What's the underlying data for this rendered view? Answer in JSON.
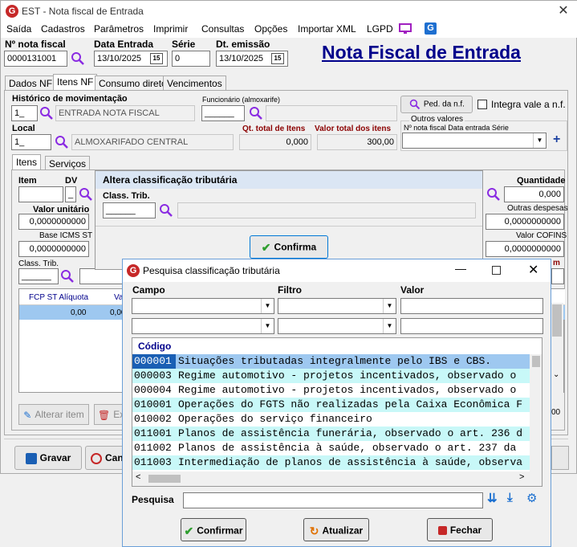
{
  "app": {
    "title": "EST - Nota fiscal de Entrada",
    "logo": "G"
  },
  "menu": [
    "Saída",
    "Cadastros",
    "Parâmetros",
    "Imprimir",
    "Consultas",
    "Opções",
    "Importar XML",
    "LGPD"
  ],
  "header": {
    "nota_label": "Nº nota fiscal",
    "nota_value": "0000131001",
    "data_entrada_label": "Data Entrada",
    "data_entrada_value": "13/10/2025",
    "serie_label": "Série",
    "serie_value": "0",
    "dt_emissao_label": "Dt. emissão",
    "dt_emissao_value": "13/10/2025",
    "big_title": "Nota Fiscal de Entrada",
    "cal_icon": "15"
  },
  "tabs": [
    "Dados NF",
    "Itens NF",
    "Consumo direto",
    "Vencimentos"
  ],
  "itens_nf": {
    "historico_label": "Histórico de movimentação",
    "historico_code": "1_",
    "historico_desc": "ENTRADA NOTA FISCAL",
    "funcionario_label": "Funcionário (almoxarife)",
    "funcionario_code": "______",
    "ped_button": "Ped. da n.f.",
    "integra_label": "Integra vale a n.f.",
    "local_label": "Local",
    "local_code": "1_",
    "local_desc": "ALMOXARIFADO CENTRAL",
    "qt_total_label": "Qt. total de Itens",
    "qt_total_value": "0,000",
    "valor_total_label": "Valor total dos itens",
    "valor_total_value": "300,00",
    "outros_label": "Outros valores",
    "outros_cols": "Nº nota fiscal   Data entrada   Série"
  },
  "subtabs": [
    "Itens",
    "Serviços"
  ],
  "item_panel": {
    "item_label": "Item",
    "dv_label": "DV",
    "dv_value": "_",
    "valor_unit_label": "Valor unitário",
    "valor_unit_value": "0,0000000000",
    "base_icms_label": "Base ICMS ST",
    "base_icms_value": "0,0000000000",
    "class_trib_label": "Class. Trib.",
    "class_trib_value": "______",
    "quantidade_label": "Quantidade",
    "quantidade_value": "0,000",
    "outras_label": "Outras despesas",
    "outras_value": "0,0000000000",
    "cofins_label": "Valor COFINS",
    "cofins_value": "0,0000000000",
    "grid_h1": "FCP ST Alíquota",
    "grid_h2": "Va",
    "grid_v1": "0,00",
    "grid_v2": "0,00",
    "alterar_btn": "Alterar item",
    "excluir_btn": "Ex",
    "red_label": "m"
  },
  "bottom": {
    "gravar": "Gravar",
    "cancelar": "Can"
  },
  "altera_dialog": {
    "title": "Altera classificação tributária",
    "label": "Class. Trib.",
    "value": "______",
    "confirm": "Confirma"
  },
  "pesquisa": {
    "title": "Pesquisa classificação tributária",
    "campo_label": "Campo",
    "filtro_label": "Filtro",
    "valor_label": "Valor",
    "col_codigo": "Código",
    "rows": [
      {
        "code": "000001",
        "desc": "Situações tributadas integralmente pelo IBS e CBS."
      },
      {
        "code": "000003",
        "desc": "Regime automotivo - projetos incentivados, observado o"
      },
      {
        "code": "000004",
        "desc": "Regime automotivo - projetos incentivados, observado o"
      },
      {
        "code": "010001",
        "desc": "Operações do FGTS não realizadas pela Caixa Econômica F"
      },
      {
        "code": "010002",
        "desc": "Operações do serviço financeiro"
      },
      {
        "code": "011001",
        "desc": "Planos de assistência funerária, observado o art. 236 d"
      },
      {
        "code": "011002",
        "desc": "Planos de assistência à saúde, observado o art. 237 da"
      },
      {
        "code": "011003",
        "desc": "Intermediação de planos de assistência à saúde, observa"
      }
    ],
    "pesquisa_label": "Pesquisa",
    "confirmar": "Confirmar",
    "atualizar": "Atualizar",
    "fechar": "Fechar"
  },
  "colors": {
    "accent": "#0078d7",
    "title_blue": "#00008b",
    "red": "#c62828",
    "cyan": "#c8f8f8",
    "selected": "#1a5fb4"
  }
}
